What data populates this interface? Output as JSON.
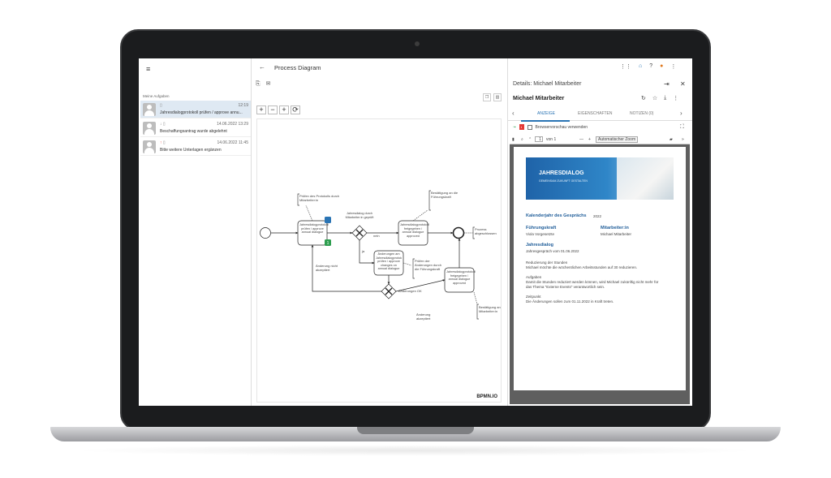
{
  "app": {
    "title": "Process Diagram",
    "menu_icon": "menu-icon",
    "back_icon": "arrow-left-icon"
  },
  "tasks": {
    "section_label": "Meine Aufgaben",
    "items": [
      {
        "date": "12:19",
        "title": "Jahresdialogprotokoll prüfen / approve annu...",
        "active": true
      },
      {
        "date": "14.06.2022 13:29",
        "title": "Beschaffungsantrag wurde abgelehnt",
        "active": false
      },
      {
        "date": "14.06.2022 11:45",
        "title": "Bitte weitere Unterlagen ergänzen",
        "active": false
      }
    ]
  },
  "diagram": {
    "logo": "BPMN.IO",
    "zoom_tools": [
      "+",
      "−",
      "+",
      "⟳"
    ],
    "annotations": {
      "a1": "Prüfen des Protokolls durch Mitarbeiter:in",
      "a2": "Bestätigung an die Führungskraft",
      "a3": "Prozess abgeschlossen",
      "a4": "Prüfen der Änderungen durch die Führungskraft",
      "a5": "Bestätigung an Mitarbeiter:in"
    },
    "tasks": {
      "t1": "Jahresdialogprotokoll prüfen / approve annual dialogue",
      "t2": "Jahresdialogprotokoll freigegeben / annual dialogue approved",
      "t3": "Änderungen am Jahresdialogprotokoll prüfen / approve changes on annual dialogue",
      "t4": "Jahresdialogprotokoll freigegeben / annual dialogue approved"
    },
    "gateways": {
      "g1": "Jahresdialog durch Mitarbeiter:in geprüft",
      "g2": "Änderungen OK"
    },
    "flows": {
      "f1": "nein",
      "f2": "ja",
      "f3": "Änderung nicht akzeptiert",
      "f4": "Änderung akzeptiert"
    },
    "badges": {
      "b1": "1"
    }
  },
  "details": {
    "title": "Details: Michael Mitarbeiter",
    "name": "Michael Mitarbeiter",
    "tabs": [
      "ANZEIGE",
      "EIGENSCHAFTEN",
      "NOTIZEN (0)"
    ],
    "browser_preview_label": "Browservorschau verwenden",
    "pdf_toolbar": {
      "page_value": "1",
      "page_of": "von 1",
      "zoom": "Automatischer Zoom"
    },
    "document": {
      "banner_title": "JAHRESDIALOG",
      "banner_subtitle": "GEMEINSAM ZUKUNFT GESTALTEN",
      "year_label": "Kalenderjahr des Gesprächs",
      "year": "2022",
      "lead_label": "Führungskraft",
      "lead_name": "Viola Vorgesetzte",
      "employee_label": "Mitarbeiter:in",
      "employee_name": "Michael Mitarbeiter",
      "dialog_label": "Jahresdialog",
      "dialog_date": "Jahresgespräch vom 01.06.2022",
      "p1a": "Reduzierung der Stunden",
      "p1b": "Michael möchte die wöchentlichen Arbeitsstunden auf 30 reduzieren.",
      "p2a": "Aufgaben",
      "p2b": "Damit die Stunden reduziert werden können, wird Michael zukünftig nicht mehr für",
      "p2c": "das Thema \"Externe Events\" verantwortlich sein.",
      "p3a": "Zeitpunkt",
      "p3b": "Die Änderungen sollen zum 01.11.2022 in Kraft treten."
    }
  },
  "colors": {
    "accent": "#2a74b4",
    "badge_green": "#2e9e4f",
    "badge_blue": "#2a74b4"
  }
}
